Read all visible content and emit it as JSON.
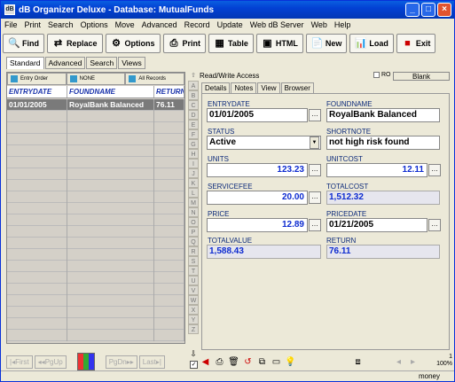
{
  "window": {
    "title": "dB Organizer Deluxe - Database: MutualFunds"
  },
  "menu": [
    "File",
    "Print",
    "Search",
    "Options",
    "Move",
    "Advanced",
    "Record",
    "Update",
    "Web dB Server",
    "Web",
    "Help"
  ],
  "toolbar": {
    "find": "Find",
    "replace": "Replace",
    "options": "Options",
    "print": "Print",
    "table": "Table",
    "html": "HTML",
    "new": "New",
    "load": "Load",
    "exit": "Exit"
  },
  "view_tabs": [
    "Standard",
    "Advanced",
    "Search",
    "Views"
  ],
  "list_buttons": {
    "order": "Entry Order",
    "filter": "NONE",
    "records": "All Records"
  },
  "grid": {
    "headers": [
      "ENTRYDATE",
      "FOUNDNAME",
      "RETURN"
    ],
    "rows": [
      [
        "01/01/2005",
        "RoyalBank Balanced",
        "76.11"
      ]
    ]
  },
  "nav": {
    "first": "First",
    "pgup": "PgUp",
    "pgdn": "PgDn",
    "last": "Last"
  },
  "alpha": [
    "A",
    "B",
    "C",
    "D",
    "E",
    "F",
    "G",
    "H",
    "I",
    "J",
    "K",
    "L",
    "M",
    "N",
    "O",
    "P",
    "Q",
    "R",
    "S",
    "T",
    "U",
    "V",
    "W",
    "X",
    "Y",
    "Z"
  ],
  "record": {
    "access": "Read/Write Access",
    "ro_label": "RO",
    "blank": "Blank"
  },
  "detail_tabs": [
    "Details",
    "Notes",
    "View",
    "Browser"
  ],
  "fields": {
    "entrydate": {
      "label": "ENTRYDATE",
      "value": "01/01/2005"
    },
    "foundname": {
      "label": "FOUNDNAME",
      "value": "RoyalBank Balanced"
    },
    "status": {
      "label": "STATUS",
      "value": "Active"
    },
    "shortnote": {
      "label": "SHORTNOTE",
      "value": "not high risk found"
    },
    "units": {
      "label": "UNITS",
      "value": "123.23"
    },
    "unitcost": {
      "label": "UNITCOST",
      "value": "12.11"
    },
    "servicefee": {
      "label": "SERVICEFEE",
      "value": "20.00"
    },
    "totalcost": {
      "label": "TOTALCOST",
      "value": "1,512.32"
    },
    "price": {
      "label": "PRICE",
      "value": "12.89"
    },
    "pricedate": {
      "label": "PRICEDATE",
      "value": "01/21/2005"
    },
    "totalvalue": {
      "label": "TOTALVALUE",
      "value": "1,588.43"
    },
    "return": {
      "label": "RETURN",
      "value": "76.11"
    }
  },
  "status": {
    "db": "money",
    "page": "1",
    "zoom": "100%"
  }
}
